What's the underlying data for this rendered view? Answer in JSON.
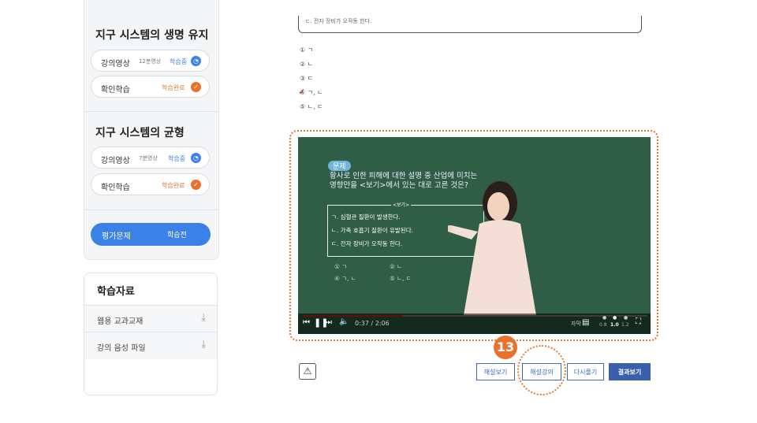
{
  "sidebar": {
    "topics": [
      {
        "title": "지구 시스템의 생명 유지",
        "items": [
          {
            "label": "강의영상",
            "meta": "12분영상",
            "status": "학습중"
          },
          {
            "label": "확인학습",
            "status": "학습완료"
          }
        ]
      },
      {
        "title": "지구 시스템의 균형",
        "items": [
          {
            "label": "강의영상",
            "meta": "7분영상",
            "status": "학습중"
          },
          {
            "label": "확인학습",
            "status": "학습완료"
          }
        ]
      }
    ],
    "eval": {
      "label": "평가문제",
      "status": "학습전"
    },
    "resources": {
      "title": "학습자료",
      "items": [
        {
          "label": "웹용 교과교재"
        },
        {
          "label": "강의 음성 파일"
        }
      ]
    }
  },
  "question": {
    "options": [
      {
        "num": "①",
        "text": "ㄱ"
      },
      {
        "num": "②",
        "text": "ㄴ"
      },
      {
        "num": "③",
        "text": "ㄷ"
      },
      {
        "num": "④",
        "text": "ㄱ, ㄴ"
      },
      {
        "num": "⑤",
        "text": "ㄴ, ㄷ"
      }
    ],
    "partial_text": "ㄷ. 전자 장비가 오작동 한다."
  },
  "video": {
    "board": {
      "tag": "문제",
      "question": "황사로 인한 피해에 대한 설명 중 산업에 미치는 영향만을 <보기>에서 있는 대로 고른 것은?",
      "box_title": "<보기>",
      "items": [
        "ㄱ. 심혈관 질환이 발생한다.",
        "ㄴ. 가축 호흡기 질환이 유발된다.",
        "ㄷ. 전자 장비가 오작동 한다."
      ],
      "answers": [
        "① ㄱ",
        "② ㄴ",
        "④ ㄱ, ㄴ",
        "⑤ ㄴ, ㄷ"
      ]
    },
    "time": "0:37 / 2:06",
    "progress": 0.29,
    "subtitle_label": "자막",
    "speeds": [
      "0.8",
      "1.0",
      "1.2"
    ]
  },
  "step_badge": "13",
  "buttons": {
    "explain_view": "해설보기",
    "explain_lecture": "해설강의",
    "retry": "다시풀기",
    "result": "결과보기"
  },
  "colors": {
    "accent": "#3b82e8",
    "orange": "#e07a36",
    "badge": "#e8712b"
  }
}
